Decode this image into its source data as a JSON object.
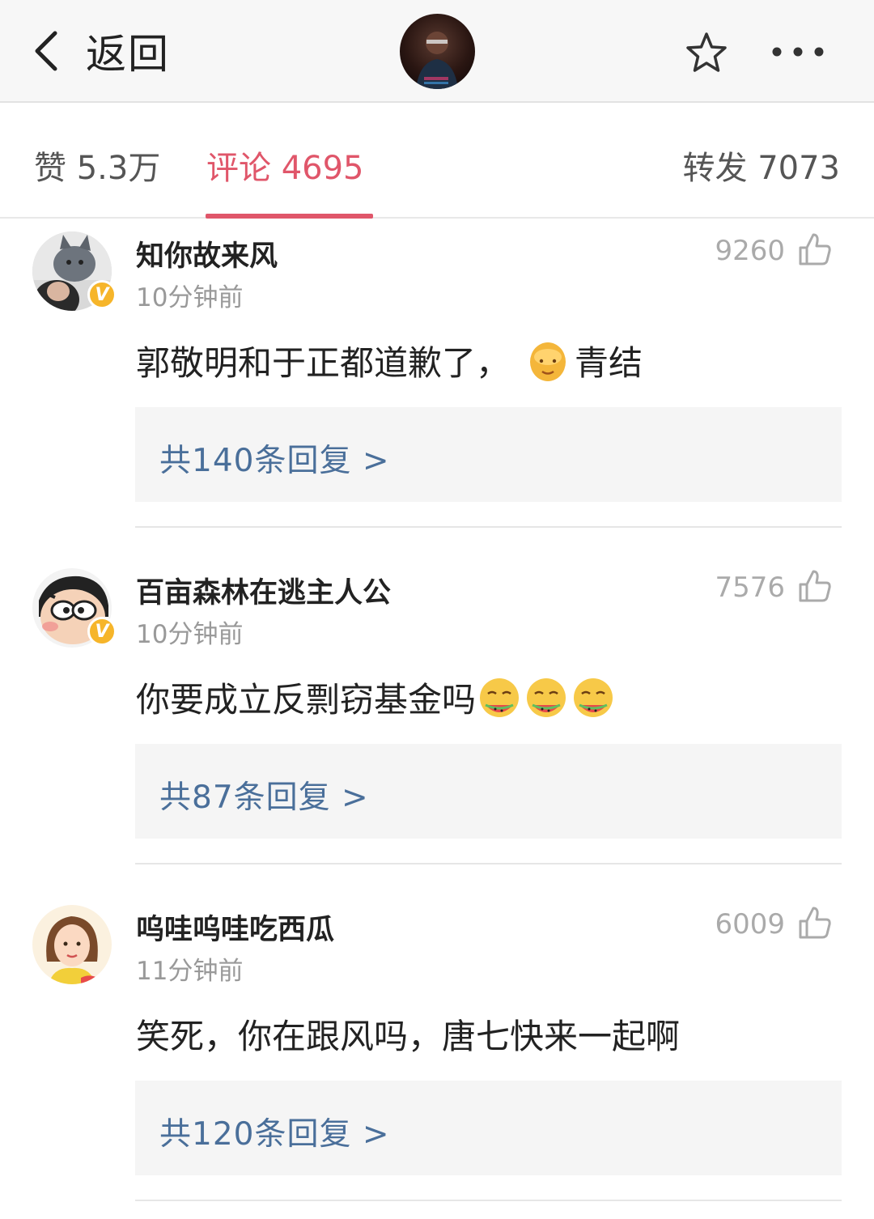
{
  "header": {
    "back_label": "返回"
  },
  "tabs": {
    "likes": "赞 5.3万",
    "comments": "评论 4695",
    "reposts": "转发 7073"
  },
  "comments": [
    {
      "username": "知你故来风",
      "time": "10分钟前",
      "likes": "9260",
      "text": "郭敬明和于正都道歉了，",
      "text_after_emoji": "青结",
      "emoji": "face-emoji",
      "replies": "共140条回复 >",
      "verified_badge": "V"
    },
    {
      "username": "百亩森林在逃主人公",
      "time": "10分钟前",
      "likes": "7576",
      "text": "你要成立反剽窃基金吗",
      "emoji": "melon-eating-emoji",
      "replies": "共87条回复 >",
      "verified_badge": "V"
    },
    {
      "username": "呜哇呜哇吃西瓜",
      "time": "11分钟前",
      "likes": "6009",
      "text": "笑死，你在跟风吗，唐七快来一起啊",
      "replies": "共120条回复 >"
    }
  ],
  "colors": {
    "accent": "#e0566a",
    "reply_link": "#4a6f9a",
    "badge": "#f6b52a"
  }
}
